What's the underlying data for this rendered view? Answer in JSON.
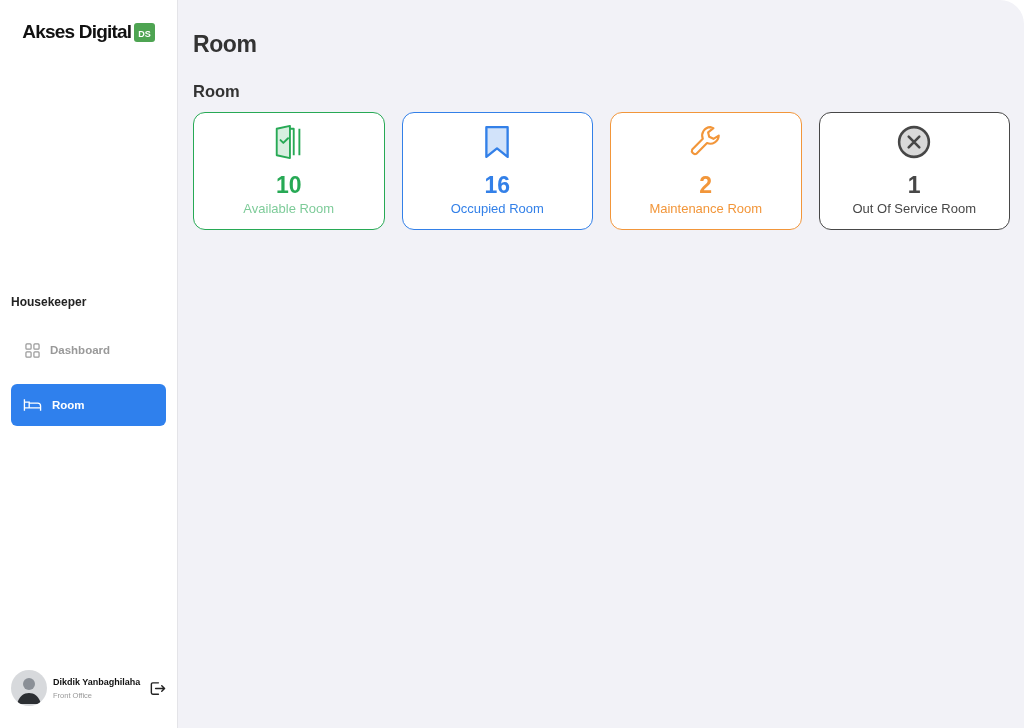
{
  "brand": {
    "name": "Akses Digital",
    "badge": "DS"
  },
  "sidebar": {
    "section": "Housekeeper",
    "items": [
      {
        "label": "Dashboard",
        "kind": "grid",
        "selected": false
      },
      {
        "label": "Room",
        "kind": "bed",
        "selected": true
      }
    ]
  },
  "user": {
    "name": "Dikdik Yanbaghilaha",
    "role": "Front Office"
  },
  "page_title": "Room",
  "section_title": "Room",
  "cards": [
    {
      "kind": "door",
      "count": "10",
      "label": "Available Room",
      "color": "#27a955"
    },
    {
      "kind": "bookmark",
      "count": "16",
      "label": "Occupied Room",
      "color": "#3380e8"
    },
    {
      "kind": "wrench",
      "count": "2",
      "label": "Maintenance Room",
      "color": "#f2963a"
    },
    {
      "kind": "cross",
      "count": "1",
      "label": "Out Of Service Room",
      "color": "#474747"
    }
  ]
}
